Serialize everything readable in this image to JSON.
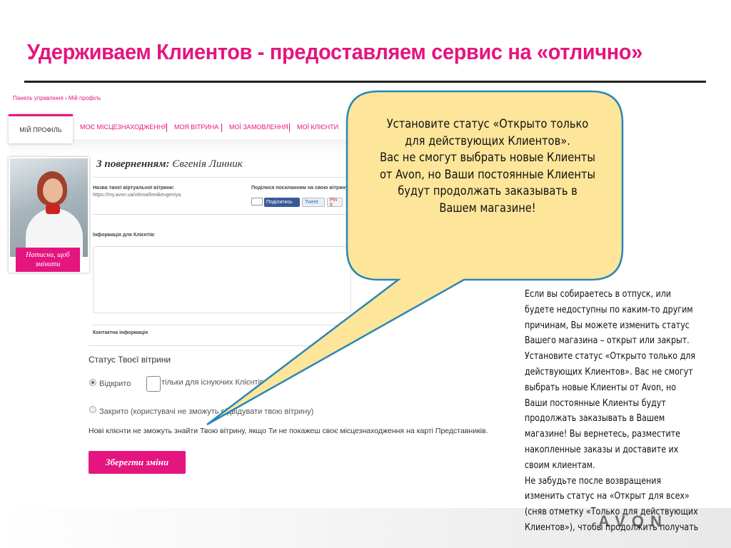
{
  "slide": {
    "title": "Удерживаем Клиентов - предоставляем сервис на «отлично»"
  },
  "breadcrumb": "Панель управління › Мій профіль",
  "tabs": [
    {
      "label": "МІЙ ПРОФІЛЬ",
      "active": true
    },
    {
      "label": "МОЄ МІСЦЕЗНАХОДЖЕННЯ",
      "active": false
    },
    {
      "label": "МОЯ ВІТРИНА",
      "active": false
    },
    {
      "label": "МОЇ ЗАМОВЛЕННЯ",
      "active": false
    },
    {
      "label": "МОЇ КЛІЄНТИ",
      "active": false
    }
  ],
  "profile": {
    "photo_button": "Натисни, щоб змінити",
    "welcome_prefix": "З поверненням:",
    "user_name": "Євгенія Линник",
    "store_name_label": "Назва твоєї віртуальної вітрини:",
    "store_url": "https://my.avon.ua/vitrina/linnikevgeniya",
    "share_label": "Поділися посиланням на свою вітрину п",
    "share_buttons": {
      "facebook": "Поділитись",
      "twitter": "Tweet",
      "pinterest": "Pin it"
    },
    "info_label": "Інформація для Клієнтів:",
    "contact_label": "Контактна інформація"
  },
  "store_status": {
    "title": "Статус Твоєї вітрини",
    "option_open": "Відкрито",
    "option_existing": "тільки для існуючих Клієнтів",
    "option_closed": "Закрито (користувачі не зможуть відвідувати твою вітрину)",
    "selected": "open",
    "notice": "Нові клієнти не зможуть знайти Твою вітрину, якщо Ти не покажеш своє місцезнаходження на карті Представників.",
    "save_button": "Зберегти зміни"
  },
  "callout": {
    "lines": [
      "Установите статус «Открыто только",
      "для действующих Клиентов».",
      "Вас не смогут выбрать новые Клиенты",
      "от Avon, но Ваши постоянные Клиенты",
      "будут продолжать заказывать в",
      "Вашем магазине!"
    ]
  },
  "description": {
    "text": "Если вы собираетесь в отпуск, или будете недоступны по каким-то другим причинам, Вы можете изменить статус Вашего магазина – открыт или закрыт. Установите статус «Открыто только для действующих Клиентов». Вас не смогут выбрать новые Клиенты от Avon, но Ваши постоянные Клиенты будут продолжать заказывать в Вашем магазине! Вы вернетесь, разместите накопленные заказы и доставите их своим клиентам.\nНе забудьте после возвращения изменить статус на «Открыт для всех» (сняв отметку «Только для действующих Клиентов»), чтобы продолжить получать"
  },
  "brand": {
    "logo": "AVON",
    "accent_color": "#e5157f",
    "callout_fill": "#fde59a",
    "callout_stroke": "#2a86b8"
  }
}
